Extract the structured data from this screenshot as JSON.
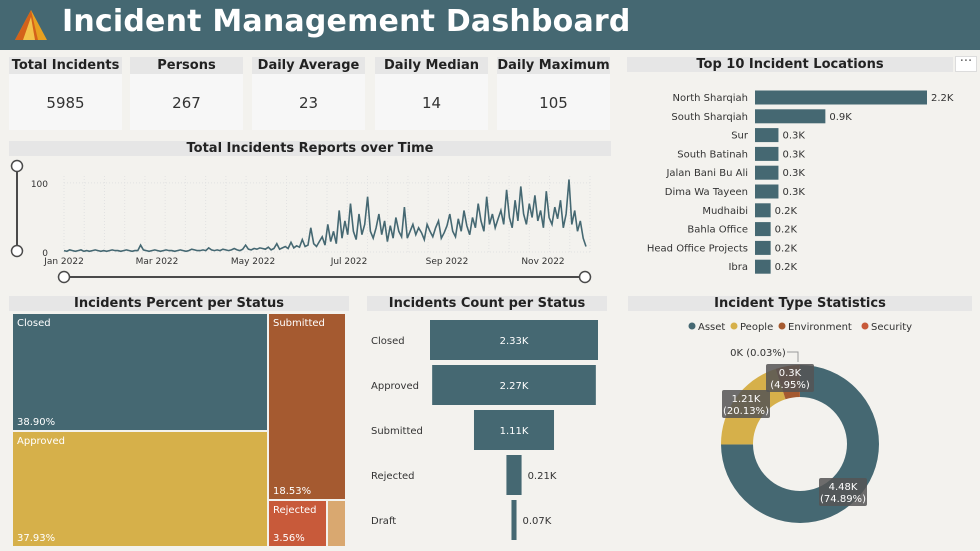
{
  "header": {
    "title": "Incident Management Dashboard",
    "logo_icon": "triangle-logo-icon"
  },
  "kpis": [
    {
      "title": "Total Incidents",
      "value": "5985"
    },
    {
      "title": "Persons",
      "value": "267"
    },
    {
      "title": "Daily Average",
      "value": "23"
    },
    {
      "title": "Daily Median",
      "value": "14"
    },
    {
      "title": "Daily Maximum",
      "value": "105"
    }
  ],
  "colors": {
    "header": "#456872",
    "asset": "#456872",
    "people": "#d6b04a",
    "environment": "#a55a30",
    "security": "#c85a3a",
    "bar": "#456872"
  },
  "locations": {
    "title": "Top 10 Incident Locations",
    "more_icon": "ellipsis-icon",
    "chart_data": {
      "type": "bar",
      "categories": [
        "North Sharqiah",
        "South Sharqiah",
        "Sur",
        "South Batinah",
        "Jalan Bani Bu Ali",
        "Dima Wa Tayeen",
        "Mudhaibi",
        "Bahla Office",
        "Head Office Projects",
        "Ibra"
      ],
      "values": [
        2200,
        900,
        300,
        300,
        300,
        300,
        200,
        200,
        200,
        200
      ],
      "labels": [
        "2.2K",
        "0.9K",
        "0.3K",
        "0.3K",
        "0.3K",
        "0.3K",
        "0.2K",
        "0.2K",
        "0.2K",
        "0.2K"
      ]
    }
  },
  "timeline": {
    "title": "Total Incidents Reports over Time",
    "chart_data": {
      "type": "line",
      "x_ticks": [
        "Jan 2022",
        "Mar 2022",
        "May 2022",
        "Jul 2022",
        "Sep 2022",
        "Nov 2022"
      ],
      "y_ticks": [
        "0",
        "100"
      ],
      "ylim": [
        0,
        110
      ],
      "grid": true,
      "series": [
        {
          "values": [
            2,
            1,
            3,
            2,
            1,
            2,
            3,
            1,
            2,
            1,
            2,
            3,
            2,
            1,
            2,
            1,
            2,
            3,
            2,
            2,
            1,
            2,
            3,
            2,
            1,
            2,
            2,
            10,
            3,
            2,
            1,
            2,
            3,
            2,
            1,
            2,
            3,
            2,
            2,
            1,
            2,
            3,
            2,
            1,
            2,
            4,
            3,
            2,
            2,
            3,
            2,
            6,
            3,
            2,
            3,
            2,
            4,
            3,
            2,
            3,
            5,
            3,
            2,
            4,
            10,
            4,
            3,
            5,
            4,
            6,
            5,
            4,
            7,
            3,
            5,
            12,
            4,
            6,
            8,
            5,
            14,
            6,
            9,
            7,
            18,
            8,
            10,
            35,
            12,
            8,
            15,
            22,
            10,
            40,
            15,
            30,
            12,
            60,
            20,
            45,
            25,
            70,
            30,
            18,
            55,
            25,
            40,
            80,
            30,
            20,
            35,
            55,
            25,
            45,
            15,
            38,
            20,
            50,
            30,
            22,
            65,
            20,
            30,
            40,
            25,
            35,
            28,
            18,
            40,
            30,
            22,
            35,
            45,
            20,
            28,
            38,
            55,
            30,
            22,
            48,
            30,
            60,
            38,
            25,
            50,
            35,
            70,
            45,
            30,
            80,
            40,
            55,
            35,
            48,
            60,
            40,
            90,
            50,
            35,
            75,
            45,
            95,
            55,
            40,
            70,
            50,
            82,
            45,
            60,
            35,
            88,
            50,
            40,
            65,
            48,
            75,
            35,
            55,
            105,
            40,
            60,
            30,
            45,
            20,
            8
          ]
        }
      ]
    }
  },
  "treemap": {
    "title": "Incidents Percent per Status",
    "chart_data": {
      "type": "treemap",
      "categories": [
        "Closed",
        "Approved",
        "Submitted",
        "Rejected",
        "Draft"
      ],
      "values": [
        38.9,
        37.93,
        18.53,
        3.56,
        1.08
      ],
      "labels": [
        "38.90%",
        "37.93%",
        "18.53%",
        "3.56%",
        ""
      ]
    }
  },
  "funnel": {
    "title": "Incidents Count per Status",
    "chart_data": {
      "type": "bar",
      "categories": [
        "Closed",
        "Approved",
        "Submitted",
        "Rejected",
        "Draft"
      ],
      "values": [
        2330,
        2270,
        1110,
        210,
        70
      ],
      "labels": [
        "2.33K",
        "2.27K",
        "1.11K",
        "0.21K",
        "0.07K"
      ]
    }
  },
  "donut": {
    "title": "Incident Type Statistics",
    "chart_data": {
      "type": "pie",
      "legend_position": "top",
      "categories": [
        "Asset",
        "People",
        "Environment",
        "Security"
      ],
      "values": [
        74.89,
        20.13,
        4.95,
        0.03
      ],
      "labels": [
        "4.48K\n(74.89%)",
        "1.21K\n(20.13%)",
        "0.3K\n(4.95%)",
        "0K (0.03%)"
      ]
    }
  }
}
